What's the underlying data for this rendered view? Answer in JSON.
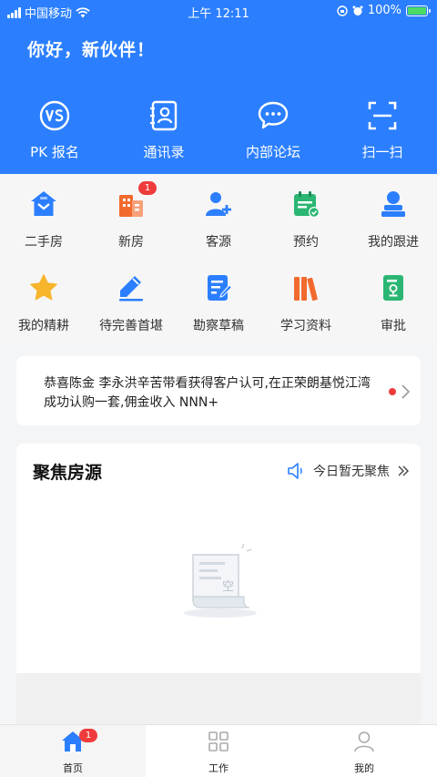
{
  "status_bar": {
    "carrier": "中国移动",
    "time": "上午 12:11",
    "battery": "100%"
  },
  "header": {
    "greeting": "你好，新伙伴！",
    "actions": [
      {
        "label": "PK 报名",
        "icon": "vs-icon"
      },
      {
        "label": "通讯录",
        "icon": "contacts-book-icon"
      },
      {
        "label": "内部论坛",
        "icon": "chat-bubble-icon"
      },
      {
        "label": "扫一扫",
        "icon": "scan-icon"
      }
    ]
  },
  "grid": {
    "row1": [
      {
        "label": "二手房",
        "icon": "house-icon"
      },
      {
        "label": "新房",
        "icon": "building-icon",
        "badge": "1"
      },
      {
        "label": "客源",
        "icon": "add-user-icon"
      },
      {
        "label": "预约",
        "icon": "calendar-check-icon"
      },
      {
        "label": "我的跟进",
        "icon": "user-stamp-icon"
      }
    ],
    "row2": [
      {
        "label": "我的精耕",
        "icon": "star-icon"
      },
      {
        "label": "待完善首堪",
        "icon": "pen-icon"
      },
      {
        "label": "勘察草稿",
        "icon": "document-edit-icon"
      },
      {
        "label": "学习资料",
        "icon": "books-icon"
      },
      {
        "label": "审批",
        "icon": "approval-doc-icon"
      }
    ]
  },
  "notice": {
    "text": "恭喜陈金 李永洪辛苦带看获得客户认可,在正荣朗基悦江湾成功认购一套,佣金收入 NNN+"
  },
  "focus": {
    "title": "聚焦房源",
    "status": "今日暂无聚焦",
    "empty_label": "空"
  },
  "tabbar": {
    "tabs": [
      {
        "label": "首页",
        "badge": "1"
      },
      {
        "label": "工作"
      },
      {
        "label": "我的"
      }
    ]
  },
  "colors": {
    "brand_blue": "#2b7fff",
    "badge_red": "#ef3b3b",
    "orange": "#f26a2e",
    "green": "#2bb673",
    "yellow": "#f7b52c"
  }
}
